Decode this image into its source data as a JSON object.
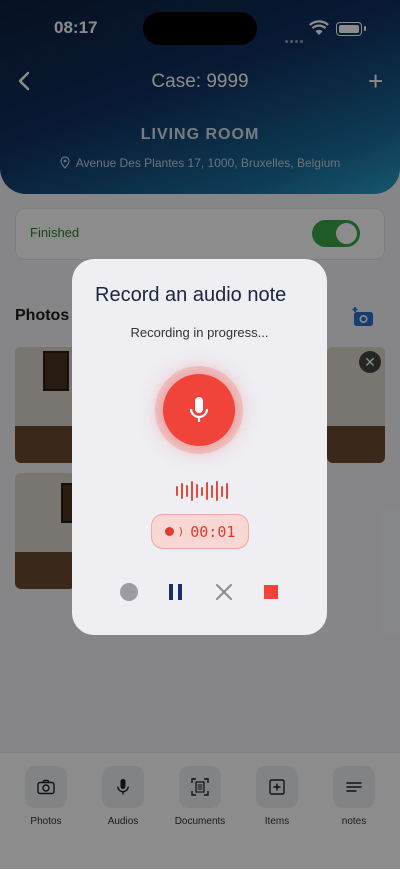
{
  "status_bar": {
    "time": "08:17"
  },
  "header": {
    "title": "Case: 9999",
    "room": "LIVING ROOM",
    "address": "Avenue Des Plantes 17, 1000, Bruxelles, Belgium"
  },
  "finished": {
    "label": "Finished",
    "enabled": true
  },
  "photos": {
    "title": "Photos"
  },
  "nav": {
    "items": [
      {
        "label": "Photos",
        "icon": "camera-icon"
      },
      {
        "label": "Audios",
        "icon": "mic-icon"
      },
      {
        "label": "Documents",
        "icon": "document-scan-icon"
      },
      {
        "label": "Items",
        "icon": "plus-square-icon"
      },
      {
        "label": "notes",
        "icon": "notes-icon"
      }
    ]
  },
  "modal": {
    "title": "Record an audio note",
    "status": "Recording in progress...",
    "timer": "00:01",
    "controls": [
      "record-icon",
      "pause-icon",
      "cancel-icon",
      "stop-icon"
    ]
  },
  "colors": {
    "accent_red": "#f0443a",
    "header_dark": "#0c1e3c",
    "toggle_green": "#3aa64a"
  }
}
